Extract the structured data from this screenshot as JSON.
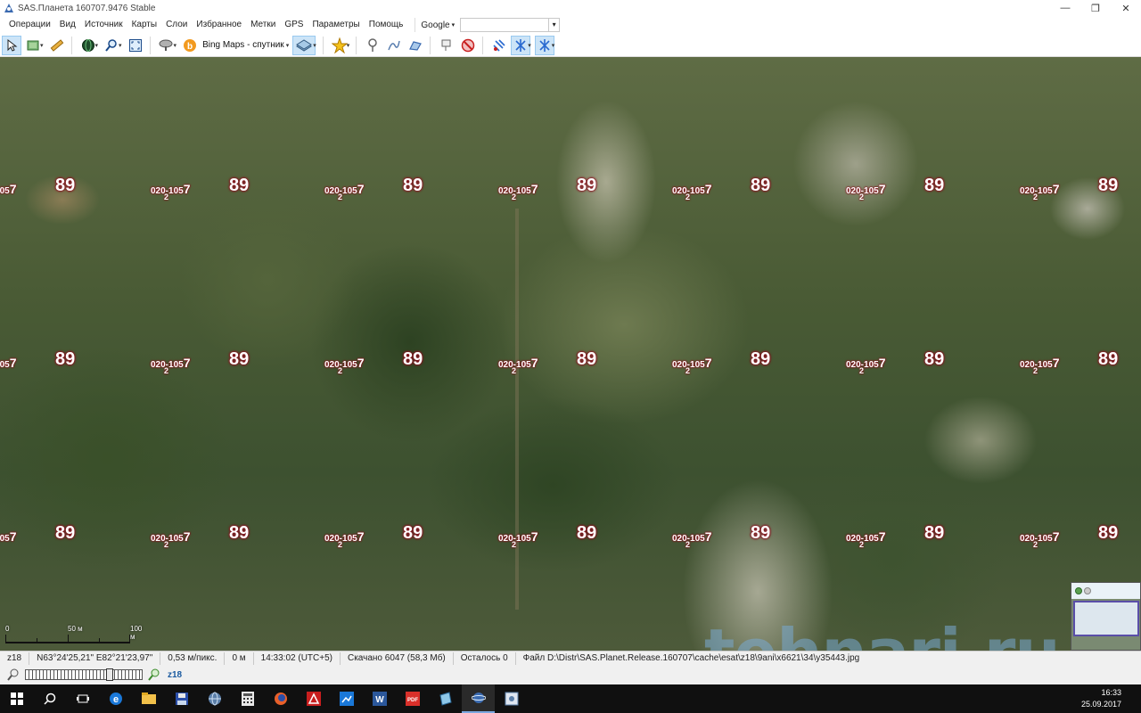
{
  "window": {
    "title": "SAS.Планета 160707.9476 Stable",
    "controls": {
      "minimize": "—",
      "maximize": "❐",
      "close": "✕"
    }
  },
  "menu": {
    "items": [
      "Операции",
      "Вид",
      "Источник",
      "Карты",
      "Слои",
      "Избранное",
      "Метки",
      "GPS",
      "Параметры",
      "Помощь"
    ],
    "source_label": "Google",
    "source_value": ""
  },
  "toolbar": {
    "map_source": "Bing Maps - спутник",
    "icons": [
      "select-arrow-icon",
      "layers-icon",
      "ruler-icon",
      "globe-icon",
      "zoom-icon",
      "fullscreen-icon",
      "satellite-dish-icon",
      "bing-icon",
      "map-type-icon",
      "star-icon",
      "pin-icon",
      "path-icon",
      "polygon-icon",
      "marks-icon",
      "no-icon",
      "gps-icon-1",
      "gps-icon-2",
      "gps-icon-3"
    ]
  },
  "map": {
    "tile_code": "020-105",
    "tile_code_big": "7",
    "tile_sub": "2",
    "tile_num": "89"
  },
  "scale": {
    "zero": "0",
    "fifty": "50 м",
    "hundred": "100 м"
  },
  "statusbar": {
    "zoom": "z18",
    "coords": "N63°24'25,21\"  E82°21'23,97\"",
    "resolution": "0,53 м/пикс.",
    "distance": "0 м",
    "time": "14:33:02 (UTC+5)",
    "downloaded": "Скачано 6047 (58,3 Мб)",
    "remaining": "Осталось 0",
    "file": "Файл D:\\Distr\\SAS.Planet.Release.160707\\cache\\esat\\z18\\9ani\\x6621\\34\\y35443.jpg"
  },
  "zoombar": {
    "level": "z18"
  },
  "watermark": "tehnari.ru",
  "taskbar": {
    "time": "16:33",
    "date": "25.09.2017"
  }
}
